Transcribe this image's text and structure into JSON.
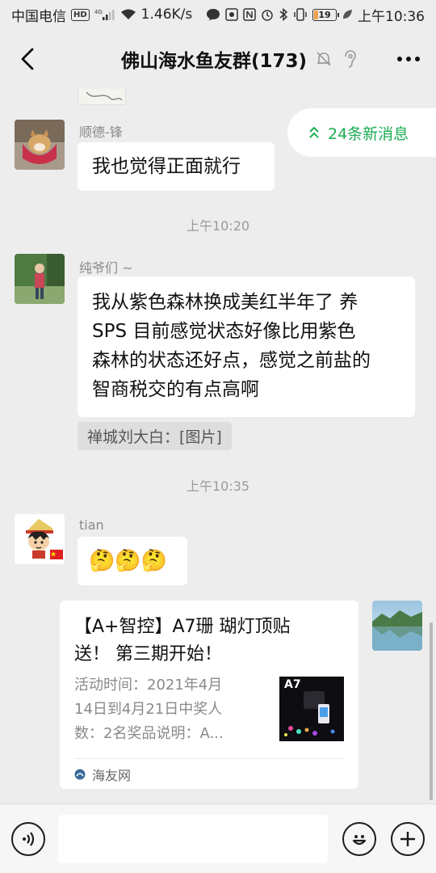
{
  "status_bar": {
    "carrier": "中国电信",
    "hd_badge": "HD",
    "network": "4G",
    "speed": "1.46K/s",
    "battery": "19",
    "battery_level": 0.19,
    "time": "上午10:36"
  },
  "header": {
    "title": "佛山海水鱼友群(173)",
    "icons": [
      "back-icon",
      "mute-bell-icon",
      "earpiece-icon",
      "more-icon"
    ]
  },
  "new_messages": {
    "label": "24条新消息"
  },
  "messages": [
    {
      "sender": "顺德-锋",
      "text": "我也觉得正面就行"
    },
    {
      "timestamp": "上午10:20"
    },
    {
      "sender": "纯爷们 ~",
      "lines": [
        "我从紫色森林换成美红半年了 养",
        "SPS  目前感觉状态好像比用紫色",
        "森林的状态还好点，感觉之前盐的",
        "智商税交的有点高啊"
      ],
      "quote": "禅城刘大白：[图片]"
    },
    {
      "timestamp": "上午10:35"
    },
    {
      "sender": "tian",
      "text": "🤔🤔🤔"
    },
    {
      "card": {
        "title_lines": [
          "【A+智控】A7珊 瑚灯顶贴",
          "送！ 第三期开始！"
        ],
        "desc_lines": [
          "活动时间：2021年4月",
          "14日到4月21日中奖人",
          "数：2名奖品说明：A..."
        ],
        "thumb_label": "A7",
        "source": "海友网"
      }
    }
  ],
  "colors": {
    "background": "#ededed",
    "new_message_green": "#1aad54",
    "bubble": "#ffffff"
  }
}
